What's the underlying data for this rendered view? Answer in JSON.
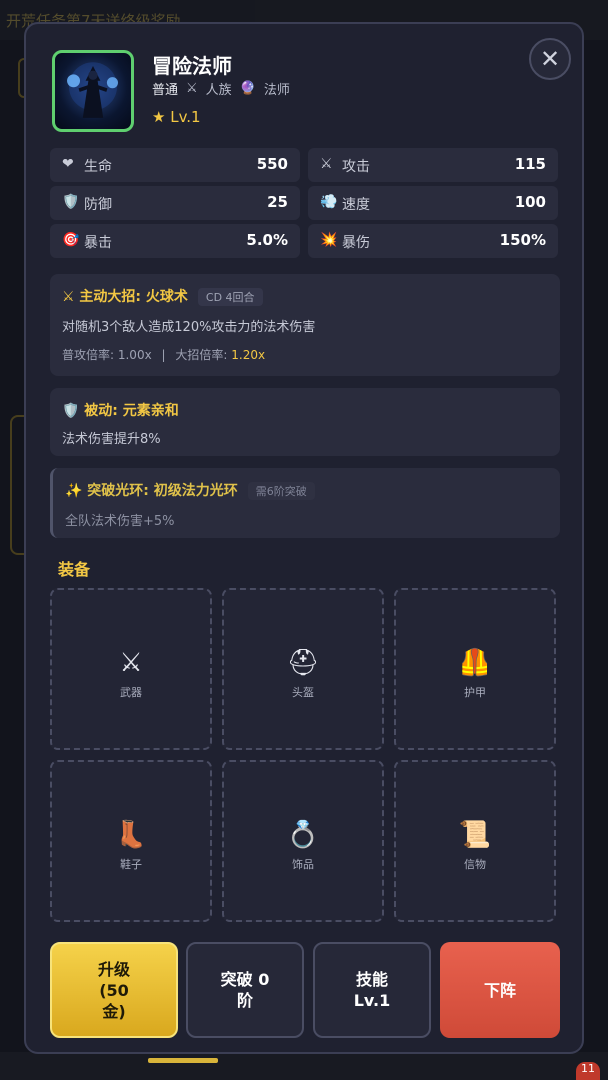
{
  "background": {
    "banner_text": "开荒任务第7天送终级奖励",
    "notification_count": "11"
  },
  "hero": {
    "name": "冒险法师",
    "rarity": "普通",
    "race_icon": "crossed-swords-icon",
    "race": "人族",
    "class_icon": "crystal-ball-icon",
    "class": "法师",
    "level": "★ Lv.1"
  },
  "close_label": "✕",
  "stats": [
    {
      "icon": "heart-icon",
      "glyph": "❤",
      "label": "生命",
      "value": "550"
    },
    {
      "icon": "crossed-swords-icon",
      "glyph": "⚔",
      "label": "攻击",
      "value": "115"
    },
    {
      "icon": "shield-icon",
      "glyph": "🛡️",
      "label": "防御",
      "value": "25"
    },
    {
      "icon": "wind-icon",
      "glyph": "💨",
      "label": "速度",
      "value": "100"
    },
    {
      "icon": "target-icon",
      "glyph": "🎯",
      "label": "暴击",
      "value": "5.0%"
    },
    {
      "icon": "explosion-icon",
      "glyph": "💥",
      "label": "暴伤",
      "value": "150%"
    }
  ],
  "active_skill": {
    "title": "⚔ 主动大招: 火球术",
    "cd": "CD 4回合",
    "desc": "对随机3个敌人造成120%攻击力的法术伤害",
    "normal_label": "普攻倍率: 1.00x",
    "separator": "|",
    "ult_label": "大招倍率: ",
    "ult_value": "1.20x"
  },
  "passive_skill": {
    "title": "🛡️ 被动: 元素亲和",
    "desc": "法术伤害提升8%"
  },
  "aura": {
    "title": "✨ 突破光环: 初级法力光环",
    "requirement": "需6阶突破",
    "desc": "全队法术伤害+5%"
  },
  "equipment": {
    "title": "装备",
    "slots": [
      {
        "icon": "sword-icon",
        "glyph": "⚔",
        "label": "武器"
      },
      {
        "icon": "helmet-icon",
        "glyph": "⛑",
        "label": "头盔"
      },
      {
        "icon": "vest-icon",
        "glyph": "🦺",
        "label": "护甲"
      },
      {
        "icon": "boot-icon",
        "glyph": "👢",
        "label": "鞋子"
      },
      {
        "icon": "ring-icon",
        "glyph": "💍",
        "label": "饰品"
      },
      {
        "icon": "scroll-icon",
        "glyph": "📜",
        "label": "信物"
      }
    ]
  },
  "actions": {
    "upgrade": "升级\n(50\n金)",
    "breakthrough": "突破 0\n阶",
    "skill": "技能\nLv.1",
    "remove": "下阵"
  }
}
